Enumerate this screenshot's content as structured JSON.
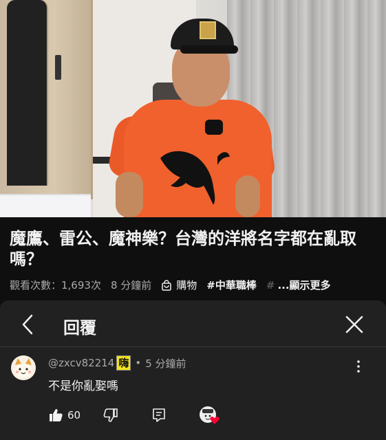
{
  "video": {
    "title": "魔鷹、雷公、魔神樂？台灣的洋將名字都在亂取嗎？"
  },
  "meta": {
    "views": "觀看次數：1,693次",
    "time_ago": "8 分鐘前",
    "shopping_label": "購物",
    "hashtag": "#中華職棒",
    "hashtag_cut": "#",
    "show_more": "...顯示更多"
  },
  "reply_panel": {
    "title": "回覆",
    "comment": {
      "handle": "@zxcv82214",
      "badge": "嗨",
      "separator": "•",
      "time_ago": "5 分鐘前",
      "text": "不是你亂娶嗎",
      "like_count": "60"
    }
  },
  "icons": {
    "back": "chevron-left-icon",
    "close": "close-icon",
    "more": "more-vertical-icon",
    "like": "thumbs-up-icon",
    "dislike": "thumbs-down-icon",
    "reply": "reply-icon",
    "shopping": "shopping-bag-icon",
    "creator_heart": "creator-heart-icon"
  },
  "colors": {
    "background": "#0f0f0f",
    "panel": "#212121",
    "text_primary": "#f1f1f1",
    "text_secondary": "#aaaaaa",
    "heart": "#ff0033",
    "badge": "#f2e21a"
  }
}
